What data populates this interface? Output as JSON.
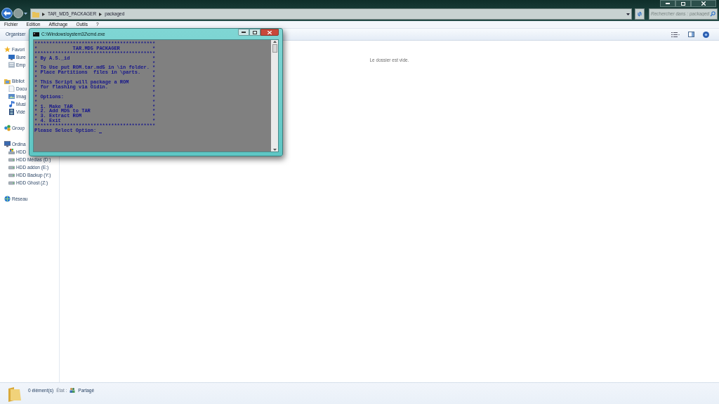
{
  "explorer": {
    "breadcrumb": [
      "TAR_MD5_PACKAGER",
      "packaged"
    ],
    "search": {
      "placeholder": "Rechercher dans : packaged"
    },
    "menu": [
      "Fichier",
      "Edition",
      "Affichage",
      "Outils",
      "?"
    ],
    "toolbar": {
      "organize": "Organiser"
    },
    "sidebar": [
      {
        "label": "Favori",
        "kind": "star",
        "children": [
          {
            "label": "Bure",
            "kind": "desktop"
          },
          {
            "label": "Emp",
            "kind": "recent"
          }
        ]
      },
      {
        "label": "Bibliot",
        "kind": "library",
        "children": [
          {
            "label": "Docu",
            "kind": "document"
          },
          {
            "label": "Imag",
            "kind": "image"
          },
          {
            "label": "Musi",
            "kind": "music"
          },
          {
            "label": "Vidé",
            "kind": "video"
          }
        ]
      },
      {
        "label": "Group",
        "kind": "homegroup"
      },
      {
        "label": "Ordina",
        "kind": "computer",
        "children": [
          {
            "label": "HDD",
            "kind": "system-drive"
          },
          {
            "label": "HDD Médias (D:)",
            "kind": "drive"
          },
          {
            "label": "HDD addon (E:)",
            "kind": "drive"
          },
          {
            "label": "HDD Backup (Y:)",
            "kind": "drive"
          },
          {
            "label": "HDD Ghost (Z:)",
            "kind": "drive"
          }
        ]
      },
      {
        "label": "Réseau",
        "kind": "network"
      }
    ],
    "empty_message": "Le dossier est vide.",
    "status_bar": {
      "count": "0 élément(s)",
      "state_label": "État :",
      "state": "Partagé"
    }
  },
  "console": {
    "title": "C:\\Windows\\system32\\cmd.exe",
    "lines": [
      "*****************************************",
      "*            TAR.MD5 PACKAGER           *",
      "*****************************************",
      "* By A.S._id                            *",
      "*                                       *",
      "* To Use put ROM.tar.md5 in \\in folder. *",
      "* Place Partitions  files in \\parts.    *",
      "*                                       *",
      "* This Script will package a ROM        *",
      "* for flashing via Oidin.               *",
      "*                                       *",
      "* Options:                              *",
      "*                                       *",
      "* 1. Make TAR                           *",
      "* 2. Add MD5 to TAR                     *",
      "* 3. Extract ROM                        *",
      "* 4. Exit                               *",
      "*****************************************",
      "Please Select Option:"
    ]
  }
}
